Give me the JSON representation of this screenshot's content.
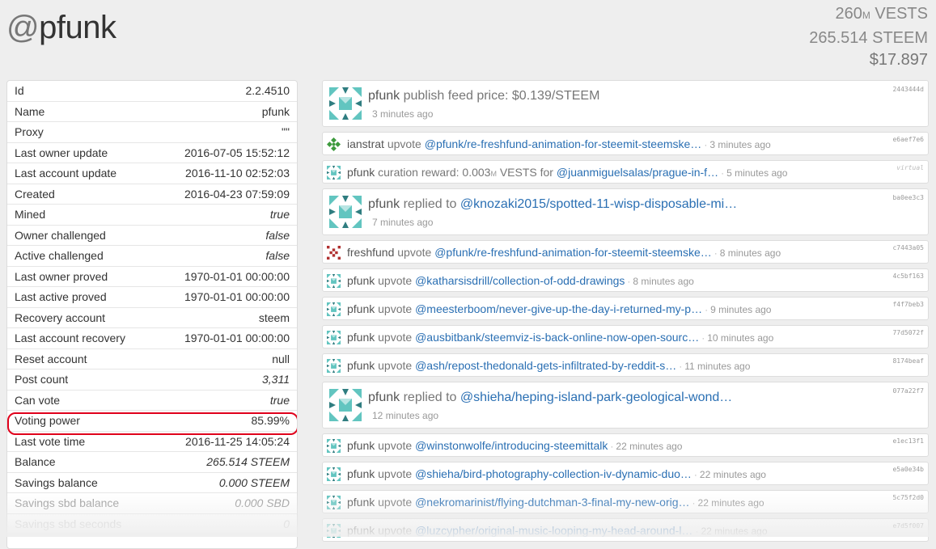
{
  "account": {
    "at": "@",
    "name": "pfunk"
  },
  "totals": {
    "vests_value": "260",
    "vests_unit": "M",
    "vests_label": " VESTS",
    "steem": "265.514 STEEM",
    "usd": "$17.897"
  },
  "properties": [
    {
      "label": "Id",
      "value": "2.2.4510",
      "italic": false
    },
    {
      "label": "Name",
      "value": "pfunk",
      "italic": false
    },
    {
      "label": "Proxy",
      "value": "\"\"",
      "italic": false
    },
    {
      "label": "Last owner update",
      "value": "2016-07-05 15:52:12",
      "italic": false
    },
    {
      "label": "Last account update",
      "value": "2016-11-10 02:52:03",
      "italic": false
    },
    {
      "label": "Created",
      "value": "2016-04-23 07:59:09",
      "italic": false
    },
    {
      "label": "Mined",
      "value": "true",
      "italic": true
    },
    {
      "label": "Owner challenged",
      "value": "false",
      "italic": true
    },
    {
      "label": "Active challenged",
      "value": "false",
      "italic": true
    },
    {
      "label": "Last owner proved",
      "value": "1970-01-01 00:00:00",
      "italic": false
    },
    {
      "label": "Last active proved",
      "value": "1970-01-01 00:00:00",
      "italic": false
    },
    {
      "label": "Recovery account",
      "value": "steem",
      "italic": false
    },
    {
      "label": "Last account recovery",
      "value": "1970-01-01 00:00:00",
      "italic": false
    },
    {
      "label": "Reset account",
      "value": "null",
      "italic": false
    },
    {
      "label": "Post count",
      "value": "3,311",
      "italic": true
    },
    {
      "label": "Can vote",
      "value": "true",
      "italic": true
    },
    {
      "label": "Voting power",
      "value": "85.99%",
      "italic": false
    },
    {
      "label": "Last vote time",
      "value": "2016-11-25 14:05:24",
      "italic": false
    },
    {
      "label": "Balance",
      "value": "265.514 STEEM",
      "italic": true
    },
    {
      "label": "Savings balance",
      "value": "0.000 STEEM",
      "italic": true
    },
    {
      "label": "Savings sbd balance",
      "value": "0.000 SBD",
      "italic": true
    },
    {
      "label": "Savings sbd seconds",
      "value": "0",
      "italic": true
    }
  ],
  "feed": [
    {
      "size": "big",
      "avatar": "pfunk",
      "user": "pfunk",
      "action": "publish feed price: $0.139/STEEM",
      "link": "",
      "ago": "3 minutes ago",
      "hash": "2443444d"
    },
    {
      "size": "small",
      "avatar": "ianstrat",
      "user": "ianstrat",
      "action": "upvote",
      "link": "@pfunk/re-freshfund-animation-for-steemit-steemske…",
      "ago": "3 minutes ago",
      "hash": "e6aef7e6"
    },
    {
      "size": "small",
      "avatar": "pfunk",
      "user": "pfunk",
      "action": "curation reward: 0.003",
      "unit": "M",
      "action2": " VESTS for",
      "link": "@juanmiguelsalas/prague-in-f…",
      "ago": "5 minutes ago",
      "hash": "virtual"
    },
    {
      "size": "big",
      "avatar": "pfunk",
      "user": "pfunk",
      "action": "replied to",
      "link": "@knozaki2015/spotted-11-wisp-disposable-mi…",
      "ago": "7 minutes ago",
      "hash": "ba0ee3c3"
    },
    {
      "size": "small",
      "avatar": "freshfund",
      "user": "freshfund",
      "action": "upvote",
      "link": "@pfunk/re-freshfund-animation-for-steemit-steemske…",
      "ago": "8 minutes ago",
      "hash": "c7443a05"
    },
    {
      "size": "small",
      "avatar": "pfunk",
      "user": "pfunk",
      "action": "upvote",
      "link": "@katharsisdrill/collection-of-odd-drawings",
      "ago": "8 minutes ago",
      "hash": "4c5bf163"
    },
    {
      "size": "small",
      "avatar": "pfunk",
      "user": "pfunk",
      "action": "upvote",
      "link": "@meesterboom/never-give-up-the-day-i-returned-my-p…",
      "ago": "9 minutes ago",
      "hash": "f4f7beb3"
    },
    {
      "size": "small",
      "avatar": "pfunk",
      "user": "pfunk",
      "action": "upvote",
      "link": "@ausbitbank/steemviz-is-back-online-now-open-sourc…",
      "ago": "10 minutes ago",
      "hash": "77d5072f"
    },
    {
      "size": "small",
      "avatar": "pfunk",
      "user": "pfunk",
      "action": "upvote",
      "link": "@ash/repost-thedonald-gets-infiltrated-by-reddit-s…",
      "ago": "11 minutes ago",
      "hash": "8174beaf"
    },
    {
      "size": "big",
      "avatar": "pfunk",
      "user": "pfunk",
      "action": "replied to",
      "link": "@shieha/heping-island-park-geological-wond…",
      "ago": "12 minutes ago",
      "hash": "077a22f7"
    },
    {
      "size": "small",
      "avatar": "pfunk",
      "user": "pfunk",
      "action": "upvote",
      "link": "@winstonwolfe/introducing-steemittalk",
      "ago": "22 minutes ago",
      "hash": "e1ec13f1"
    },
    {
      "size": "small",
      "avatar": "pfunk",
      "user": "pfunk",
      "action": "upvote",
      "link": "@shieha/bird-photography-collection-iv-dynamic-duo…",
      "ago": "22 minutes ago",
      "hash": "e5a0e34b"
    },
    {
      "size": "small",
      "avatar": "pfunk",
      "user": "pfunk",
      "action": "upvote",
      "link": "@nekromarinist/flying-dutchman-3-final-my-new-orig…",
      "ago": "22 minutes ago",
      "hash": "5c75f2d0"
    },
    {
      "size": "small",
      "avatar": "pfunk",
      "user": "pfunk",
      "action": "upvote",
      "link": "@luzcypher/original-music-looping-my-head-around-l…",
      "ago": "22 minutes ago",
      "hash": "e7d5f007"
    }
  ],
  "colors": {
    "link": "#2a6fb3",
    "highlight": "#e0001b",
    "avatar_pfunk_a": "#62c5c0",
    "avatar_pfunk_b": "#2f7d80",
    "avatar_ianstrat": "#3d9a3d",
    "avatar_freshfund": "#b03030"
  }
}
